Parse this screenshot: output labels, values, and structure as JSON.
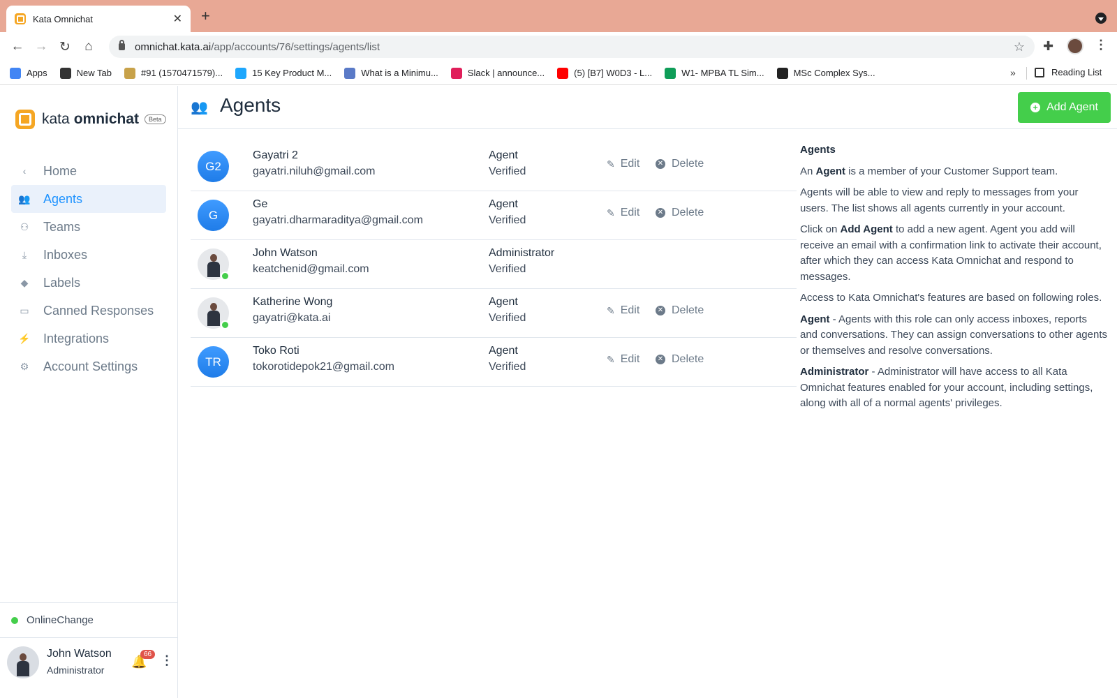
{
  "browser": {
    "tab_title": "Kata Omnichat",
    "url_host": "omnichat.kata.ai",
    "url_path": "/app/accounts/76/settings/agents/list",
    "bookmarks": [
      {
        "label": "Apps",
        "color": "#4285f4"
      },
      {
        "label": "New Tab",
        "color": "#333333"
      },
      {
        "label": "#91 (1570471579)...",
        "color": "#c8a24a"
      },
      {
        "label": "15 Key Product M...",
        "color": "#1ea7fd"
      },
      {
        "label": "What is a Minimu...",
        "color": "#5a7ac7"
      },
      {
        "label": "Slack | announce...",
        "color": "#e01e5a"
      },
      {
        "label": "(5) [B7] W0D3 - L...",
        "color": "#ff0000"
      },
      {
        "label": "W1- MPBA TL Sim...",
        "color": "#0f9d58"
      },
      {
        "label": "MSc Complex Sys...",
        "color": "#222222"
      }
    ],
    "more": "»",
    "reading_list": "Reading List"
  },
  "sidebar": {
    "brand_kata": "kata",
    "brand_omni": "omnichat",
    "brand_beta": "Beta",
    "items": [
      {
        "label": "Home",
        "icon": "‹",
        "active": false
      },
      {
        "label": "Agents",
        "icon": "👥",
        "active": true
      },
      {
        "label": "Teams",
        "icon": "⚇",
        "active": false
      },
      {
        "label": "Inboxes",
        "icon": "⤓",
        "active": false
      },
      {
        "label": "Labels",
        "icon": "◆",
        "active": false
      },
      {
        "label": "Canned Responses",
        "icon": "▭",
        "active": false
      },
      {
        "label": "Integrations",
        "icon": "⚡",
        "active": false
      },
      {
        "label": "Account Settings",
        "icon": "⚙",
        "active": false
      }
    ],
    "status": "Online",
    "change": "Change",
    "user_name": "John Watson",
    "user_role": "Administrator",
    "notifications": "66"
  },
  "header": {
    "title": "Agents",
    "add_button": "Add Agent"
  },
  "agents": [
    {
      "initials": "G2",
      "photo": false,
      "online": false,
      "name": "Gayatri 2",
      "email": "gayatri.niluh@gmail.com",
      "role": "Agent",
      "status": "Verified",
      "edit": "Edit",
      "delete": "Delete"
    },
    {
      "initials": "G",
      "photo": false,
      "online": false,
      "name": "Ge",
      "email": "gayatri.dharmaraditya@gmail.com",
      "role": "Agent",
      "status": "Verified",
      "edit": "Edit",
      "delete": "Delete"
    },
    {
      "initials": "",
      "photo": true,
      "online": true,
      "name": "John Watson",
      "email": "keatchenid@gmail.com",
      "role": "Administrator",
      "status": "Verified",
      "edit": "",
      "delete": ""
    },
    {
      "initials": "",
      "photo": true,
      "online": true,
      "name": "Katherine Wong",
      "email": "gayatri@kata.ai",
      "role": "Agent",
      "status": "Verified",
      "edit": "Edit",
      "delete": "Delete"
    },
    {
      "initials": "TR",
      "photo": false,
      "online": false,
      "name": "Toko Roti",
      "email": "tokorotidepok21@gmail.com",
      "role": "Agent",
      "status": "Verified",
      "edit": "Edit",
      "delete": "Delete"
    }
  ],
  "help": {
    "title": "Agents",
    "p1_a": "An ",
    "p1_b": "Agent",
    "p1_c": " is a member of your Customer Support team.",
    "p2": "Agents will be able to view and reply to messages from your users. The list shows all agents currently in your account.",
    "p3_a": "Click on ",
    "p3_b": "Add Agent",
    "p3_c": " to add a new agent. Agent you add will receive an email with a confirmation link to activate their account, after which they can access Kata Omnichat and respond to messages.",
    "p4": "Access to Kata Omnichat's features are based on following roles.",
    "p5_b": "Agent",
    "p5_c": " - Agents with this role can only access inboxes, reports and conversations. They can assign conversations to other agents or themselves and resolve conversations.",
    "p6_b": "Administrator",
    "p6_c": " - Administrator will have access to all Kata Omnichat features enabled for your account, including settings, along with all of a normal agents' privileges."
  },
  "colors": {
    "accent": "#1f93ff",
    "success": "#44ce4b",
    "chrome": "#e8a895"
  }
}
